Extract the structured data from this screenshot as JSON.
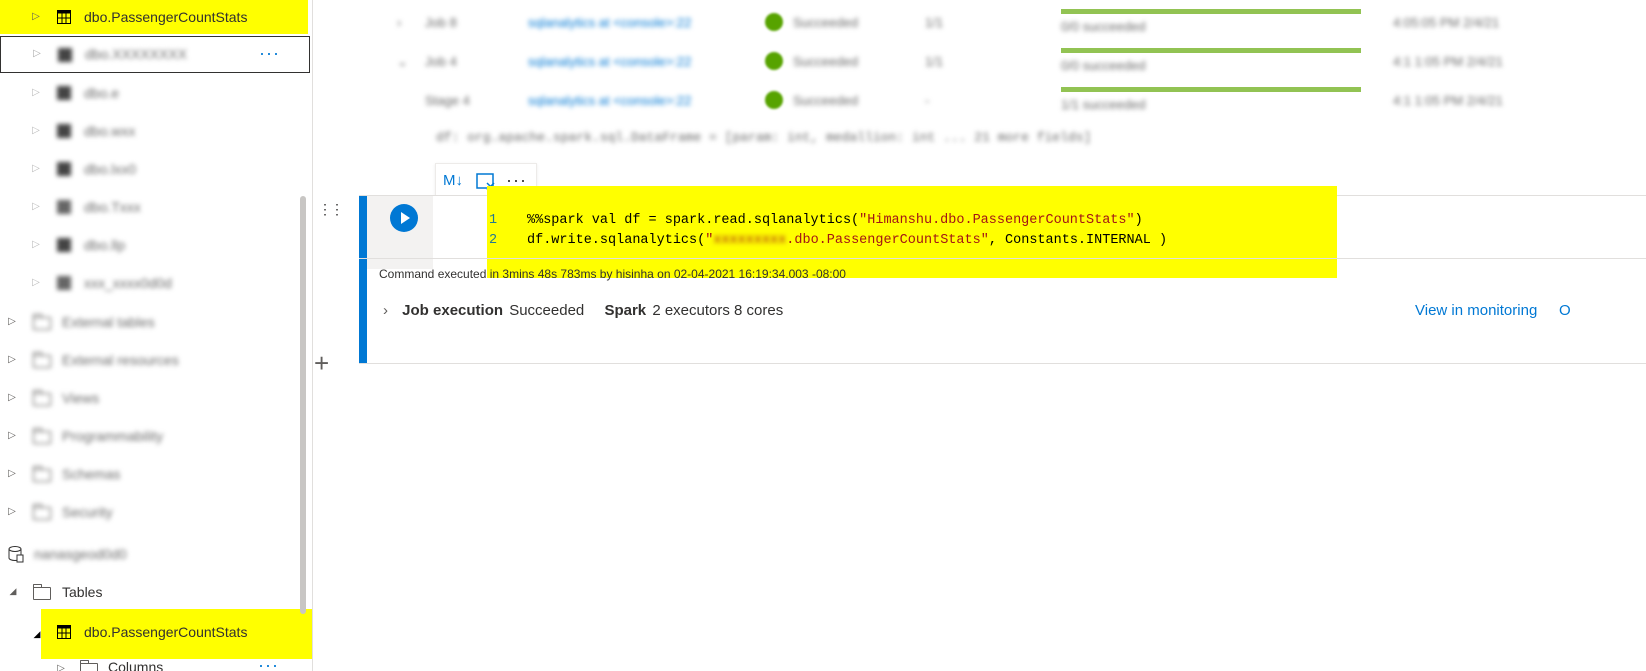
{
  "sidebar": {
    "top_table": "dbo.PassengerCountStats",
    "blurred_items": [
      "dbo.XXXXXXXX",
      "dbo.e",
      "dbo.wxx",
      "dbo.lxx0",
      "dbo.Txxx",
      "dbo.llp",
      "xxx_xxxx0d0d"
    ],
    "blurred_folders": [
      "External tables",
      "External resources",
      "Views",
      "Programmability",
      "Schemas",
      "Security"
    ],
    "database_name": "nanasgeod0d0",
    "tables_label": "Tables",
    "selected_table": "dbo.PassengerCountStats",
    "columns_label": "Columns"
  },
  "jobs": {
    "rows": [
      {
        "id": "Job 8",
        "link": "sqlanalytics at <console>:22",
        "status": "Succeeded",
        "tasks": "1/1",
        "progress_text": "0/0 succeeded",
        "time": "4:05:05 PM 2/4/21",
        "progress": 1.0
      },
      {
        "id": "Job 4",
        "link": "sqlanalytics at <console>:22",
        "status": "Succeeded",
        "tasks": "1/1",
        "progress_text": "0/0 succeeded",
        "time": "4:1 1:05 PM 2/4/21",
        "progress": 1.0
      },
      {
        "id": "Stage 4",
        "link": "sqlanalytics at <console>:22",
        "status": "Succeeded",
        "tasks": "-",
        "progress_text": "1/1 succeeded",
        "time": "4:1 1:05 PM 2/4/21",
        "progress": 1.0
      }
    ],
    "schema_line": "df: org.apache.spark.sql.DataFrame = [param: int, medallion: int ... 21 more fields]"
  },
  "cell_toolbar": {
    "md_icon": "markdown-icon",
    "clear_icon": "clear-output-icon",
    "more": "···"
  },
  "cell": {
    "line1_num": "1",
    "line2_num": "2",
    "line1_pre": "%%spark val df = spark.read.sqlanalytics(",
    "line1_str": "\"Himanshu.dbo.PassengerCountStats\"",
    "line1_post": ")",
    "line2_pre": "df.write.sqlanalytics(",
    "line2_str_open": "\"",
    "line2_str_blur": "xxxxxxxxx",
    "line2_str_rest": ".dbo.PassengerCountStats\"",
    "line2_post": ", Constants.INTERNAL )",
    "status": "Command executed in 3mins 48s 783ms by hisinha on 02-04-2021 16:19:34.003 -08:00",
    "job_exec_label": "Job execution",
    "job_exec_status": "Succeeded",
    "spark_label": "Spark",
    "spark_detail": "2 executors 8 cores",
    "view_monitoring": "View in monitoring",
    "cut_link": "O"
  },
  "add_cell": "+",
  "colors": {
    "accent": "#0078d4",
    "highlight": "#ffff00",
    "success": "#57a300"
  }
}
